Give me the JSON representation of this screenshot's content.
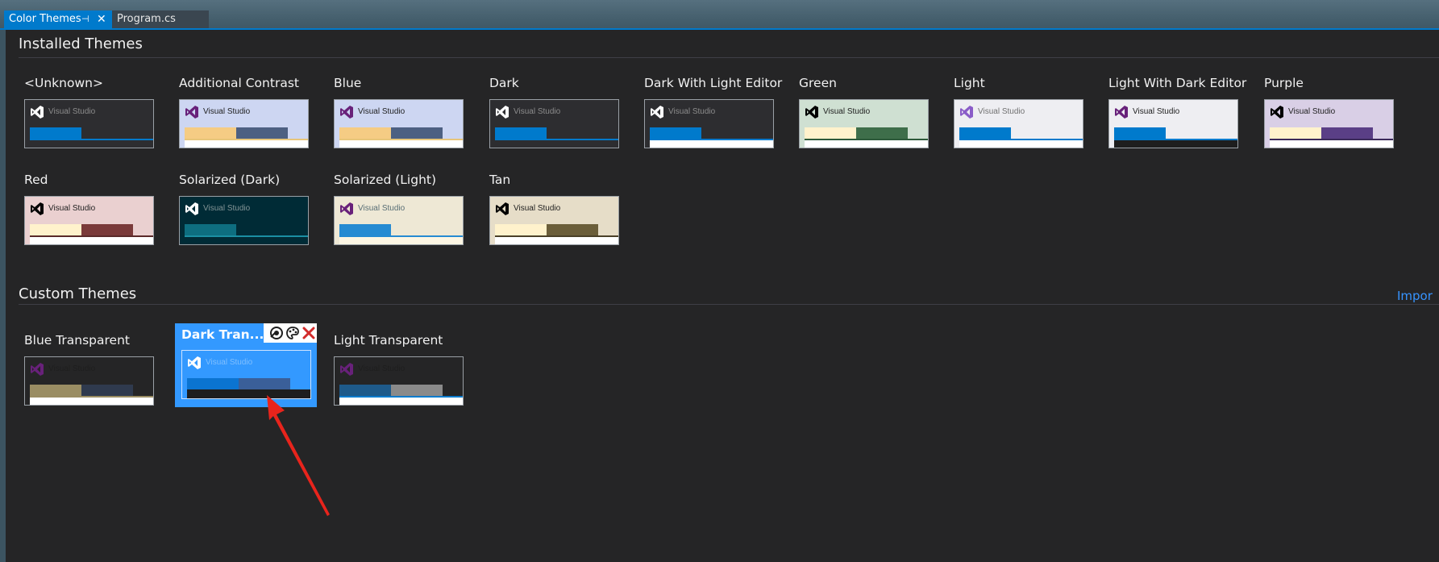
{
  "tabs": [
    {
      "label": "Color Themes",
      "active": true
    },
    {
      "label": "Program.cs",
      "active": false
    }
  ],
  "installed": {
    "title": "Installed Themes",
    "themes": [
      {
        "name": "<Unknown>",
        "bg": "#2d2d30",
        "text": "#8c8c8c",
        "logo": "#ffffff",
        "barA": "#007acc",
        "barB": "#2d2d30",
        "line": "#007acc",
        "bottom": "#2d2d30"
      },
      {
        "name": "Additional Contrast",
        "bg": "#cdd6f2",
        "text": "#1e1e1e",
        "logo": "#68217a",
        "barA": "#f5cc84",
        "barB": "#4d6082",
        "line": "#e8c67a",
        "bottom": "#ffffff"
      },
      {
        "name": "Blue",
        "bg": "#cdd6f2",
        "text": "#1e1e1e",
        "logo": "#68217a",
        "barA": "#f5cc84",
        "barB": "#4d6082",
        "line": "#e8c67a",
        "bottom": "#ffffff"
      },
      {
        "name": "Dark",
        "bg": "#2d2d30",
        "text": "#8c8c8c",
        "logo": "#ffffff",
        "barA": "#007acc",
        "barB": "#2d2d30",
        "line": "#007acc",
        "bottom": "#2d2d30"
      },
      {
        "name": "Dark With Light Editor",
        "bg": "#2d2d30",
        "text": "#8c8c8c",
        "logo": "#ffffff",
        "barA": "#007acc",
        "barB": "#2d2d30",
        "line": "#007acc",
        "bottom": "#ffffff"
      },
      {
        "name": "Green",
        "bg": "#cfe0d2",
        "text": "#1e1e1e",
        "logo": "#000000",
        "barA": "#fff2cc",
        "barB": "#3e6e4a",
        "line": "#2d5a3a",
        "bottom": "#ffffff"
      },
      {
        "name": "Light",
        "bg": "#eeeef2",
        "text": "#717171",
        "logo": "#8a5cc8",
        "barA": "#007acc",
        "barB": "#eeeef2",
        "line": "#007acc",
        "bottom": "#ffffff"
      },
      {
        "name": "Light With Dark Editor",
        "bg": "#eeeef2",
        "text": "#1e1e1e",
        "logo": "#68217a",
        "barA": "#007acc",
        "barB": "#eeeef2",
        "line": "#007acc",
        "bottom": "#1e1e1e"
      },
      {
        "name": "Purple",
        "bg": "#d9cfe6",
        "text": "#1e1e1e",
        "logo": "#000000",
        "barA": "#fff2cc",
        "barB": "#5a3f86",
        "line": "#3b2a5a",
        "bottom": "#ffffff"
      },
      {
        "name": "Red",
        "bg": "#ead0d0",
        "text": "#1e1e1e",
        "logo": "#000000",
        "barA": "#fff2cc",
        "barB": "#7a3a3a",
        "line": "#5a2a2a",
        "bottom": "#ffffff"
      },
      {
        "name": "Solarized (Dark)",
        "bg": "#002b36",
        "text": "#839496",
        "logo": "#ffffff",
        "barA": "#0e6e80",
        "barB": "#002b36",
        "line": "#1b8fa3",
        "bottom": "#002b36"
      },
      {
        "name": "Solarized (Light)",
        "bg": "#eee8d5",
        "text": "#586e75",
        "logo": "#68217a",
        "barA": "#268bd2",
        "barB": "#eee8d5",
        "line": "#268bd2",
        "bottom": "#fdf6e3"
      },
      {
        "name": "Tan",
        "bg": "#e6ddc8",
        "text": "#1e1e1e",
        "logo": "#000000",
        "barA": "#fff2cc",
        "barB": "#6b5e3a",
        "line": "#4a4028",
        "bottom": "#ffffff"
      }
    ]
  },
  "custom": {
    "title": "Custom Themes",
    "import_label": "Impor",
    "themes": [
      {
        "name": "Blue Transparent",
        "bg": "#252526",
        "text": "#1e1e1e",
        "logo": "#68217a",
        "barA": "#9a8d63",
        "barB": "#2f3a4e",
        "line": "#9a8d63",
        "bottom": "#ffffff"
      },
      {
        "name": "Dark Tran...",
        "bg": "#3399ff",
        "text": "#7fbfff",
        "logo": "#ffffff",
        "barA": "#0b74d1",
        "barB": "#3a5f99",
        "line": "#1e1e1e",
        "bottom": "#1e1e1e"
      },
      {
        "name": "Light Transparent",
        "bg": "#252526",
        "text": "#1e1e1e",
        "logo": "#68217a",
        "barA": "#1e5a8a",
        "barB": "#8a8a8a",
        "line": "#007acc",
        "bottom": "#ffffff"
      }
    ]
  },
  "vs_label": "Visual Studio",
  "selected_actions": [
    "edit-theme-icon",
    "customize-colors-icon",
    "delete-theme-icon"
  ],
  "accent": "#007acc",
  "selection": "#3399ff",
  "annotation_color": "#e8241c"
}
